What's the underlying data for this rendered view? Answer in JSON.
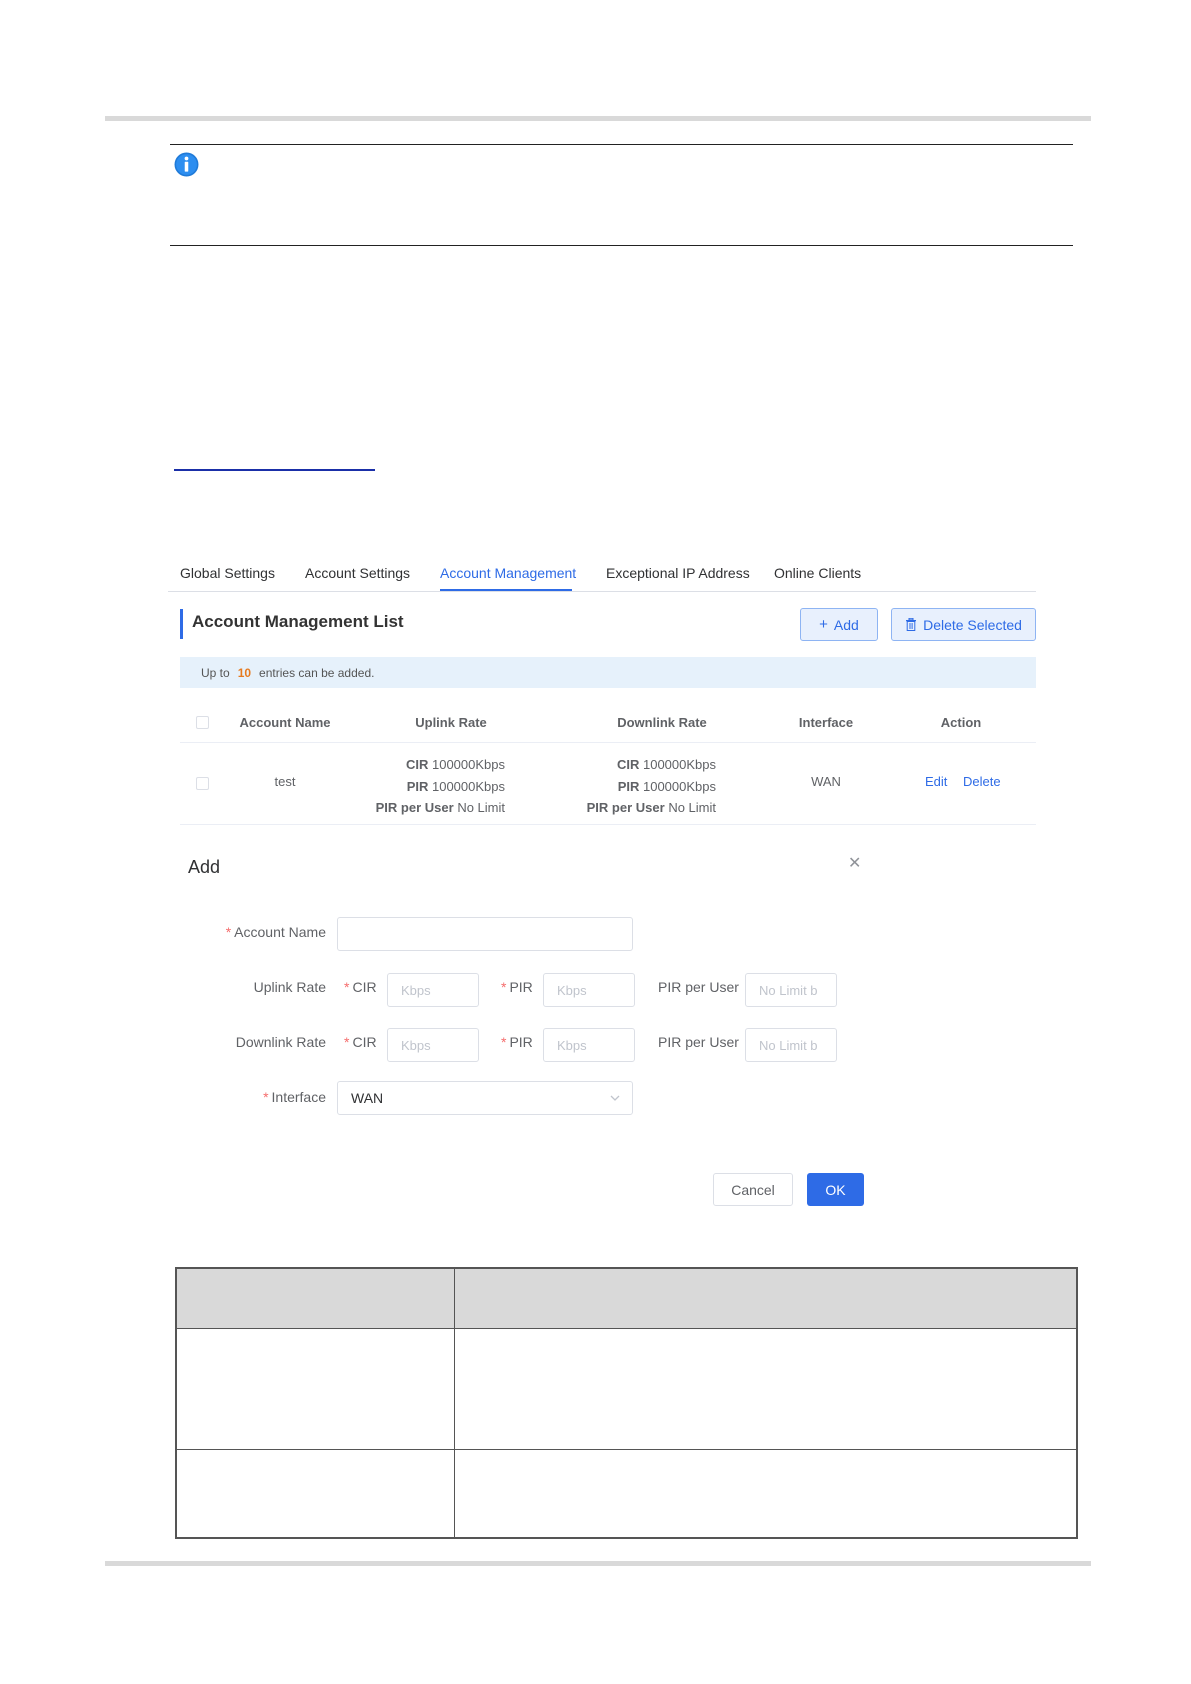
{
  "tabs": [
    {
      "label": "Global Settings",
      "active": false
    },
    {
      "label": "Account Settings",
      "active": false
    },
    {
      "label": "Account Management",
      "active": true
    },
    {
      "label": "Exceptional IP Address",
      "active": false
    },
    {
      "label": "Online Clients",
      "active": false
    }
  ],
  "list": {
    "title": "Account Management List",
    "add_label": "Add",
    "delete_selected_label": "Delete Selected",
    "notice_prefix": "Up to",
    "notice_count": "10",
    "notice_suffix": "entries can be added."
  },
  "table": {
    "headers": [
      "Account Name",
      "Uplink Rate",
      "Downlink Rate",
      "Interface",
      "Action"
    ],
    "rows": [
      {
        "account_name": "test",
        "uplink": {
          "cir": "100000Kbps",
          "pir": "100000Kbps",
          "pir_per_user": "No Limit"
        },
        "downlink": {
          "cir": "100000Kbps",
          "pir": "100000Kbps",
          "pir_per_user": "No Limit"
        },
        "interface": "WAN",
        "actions": [
          "Edit",
          "Delete"
        ]
      }
    ],
    "labels": {
      "cir": "CIR",
      "pir": "PIR",
      "pir_per_user": "PIR per User"
    }
  },
  "dialog": {
    "title": "Add",
    "account_name_label": "Account Name",
    "uplink_label": "Uplink Rate",
    "downlink_label": "Downlink Rate",
    "cir_label": "CIR",
    "pir_label": "PIR",
    "pir_per_user_label": "PIR per User",
    "rate_placeholder": "Kbps",
    "no_limit_placeholder": "No Limit b",
    "interface_label": "Interface",
    "interface_value": "WAN",
    "cancel_label": "Cancel",
    "ok_label": "OK"
  },
  "colors": {
    "accent": "#2e6be6",
    "notice_bg": "#e6f1fb",
    "count": "#e67a1f",
    "required": "#f56c6c"
  }
}
